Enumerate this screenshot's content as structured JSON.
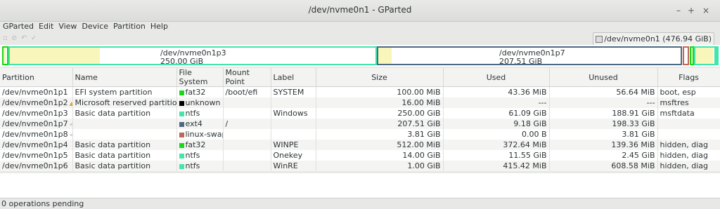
{
  "window": {
    "title": "/dev/nvme0n1 - GParted",
    "min": "–",
    "max": "+",
    "close": "×"
  },
  "menu": [
    "GParted",
    "Edit",
    "View",
    "Device",
    "Partition",
    "Help"
  ],
  "device_selector": "/dev/nvme0n1 (476.94 GiB)",
  "visual": {
    "p3": {
      "name": "/dev/nvme0n1p3",
      "size": "250.00 GiB"
    },
    "p7": {
      "name": "/dev/nvme0n1p7",
      "size": "207.51 GiB"
    }
  },
  "columns": [
    "Partition",
    "Name",
    "File System",
    "Mount Point",
    "Label",
    "Size",
    "Used",
    "Unused",
    "Flags"
  ],
  "rows": [
    {
      "partition": "/dev/nvme0n1p1",
      "name": "EFI system partition",
      "fs": "fat32",
      "fs_color": "#18d918",
      "mount": "/boot/efi",
      "label": "SYSTEM",
      "size": "100.00 MiB",
      "used": "43.36 MiB",
      "unused": "56.64 MiB",
      "flags": "boot, esp",
      "icon": ""
    },
    {
      "partition": "/dev/nvme0n1p2",
      "name": "Microsoft reserved partition",
      "fs": "unknown",
      "fs_color": "#000000",
      "mount": "",
      "label": "",
      "size": "16.00 MiB",
      "used": "---",
      "unused": "---",
      "flags": "msftres",
      "icon": "warn"
    },
    {
      "partition": "/dev/nvme0n1p3",
      "name": "Basic data partition",
      "fs": "ntfs",
      "fs_color": "#42e5ac",
      "mount": "",
      "label": "Windows",
      "size": "250.00 GiB",
      "used": "61.09 GiB",
      "unused": "188.91 GiB",
      "flags": "msftdata",
      "icon": ""
    },
    {
      "partition": "/dev/nvme0n1p7",
      "name": "",
      "fs": "ext4",
      "fs_color": "#4b6983",
      "mount": "/",
      "label": "",
      "size": "207.51 GiB",
      "used": "9.18 GiB",
      "unused": "198.33 GiB",
      "flags": "",
      "icon": "lock"
    },
    {
      "partition": "/dev/nvme0n1p8",
      "name": "",
      "fs": "linux-swap",
      "fs_color": "#c1665a",
      "mount": "",
      "label": "",
      "size": "3.81 GiB",
      "used": "0.00 B",
      "unused": "3.81 GiB",
      "flags": "",
      "icon": "lock"
    },
    {
      "partition": "/dev/nvme0n1p4",
      "name": "Basic data partition",
      "fs": "fat32",
      "fs_color": "#18d918",
      "mount": "",
      "label": "WINPE",
      "size": "512.00 MiB",
      "used": "372.64 MiB",
      "unused": "139.36 MiB",
      "flags": "hidden, diag",
      "icon": ""
    },
    {
      "partition": "/dev/nvme0n1p5",
      "name": "Basic data partition",
      "fs": "ntfs",
      "fs_color": "#42e5ac",
      "mount": "",
      "label": "Onekey",
      "size": "14.00 GiB",
      "used": "11.55 GiB",
      "unused": "2.45 GiB",
      "flags": "hidden, diag",
      "icon": ""
    },
    {
      "partition": "/dev/nvme0n1p6",
      "name": "Basic data partition",
      "fs": "ntfs",
      "fs_color": "#42e5ac",
      "mount": "",
      "label": "WinRE",
      "size": "1.00 GiB",
      "used": "415.42 MiB",
      "unused": "608.58 MiB",
      "flags": "hidden, diag",
      "icon": ""
    }
  ],
  "status": "0 operations pending"
}
